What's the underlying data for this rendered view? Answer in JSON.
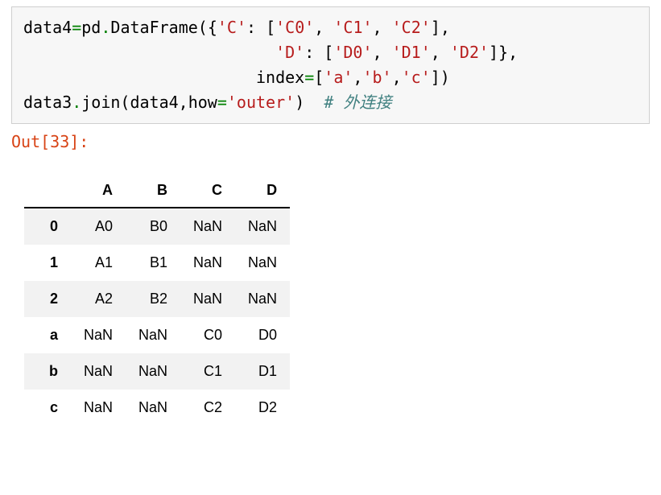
{
  "code": {
    "l1_p1": "data4",
    "l1_eq": "=",
    "l1_p2": "pd",
    "l1_dot": ".",
    "l1_p3": "DataFrame({",
    "l1_s1": "'C'",
    "l1_p4": ": [",
    "l1_s2": "'C0'",
    "l1_c1": ", ",
    "l1_s3": "'C1'",
    "l1_c2": ", ",
    "l1_s4": "'C2'",
    "l1_p5": "],",
    "l2_pad": "                          ",
    "l2_s1": "'D'",
    "l2_p1": ": [",
    "l2_s2": "'D0'",
    "l2_c1": ", ",
    "l2_s3": "'D1'",
    "l2_c2": ", ",
    "l2_s4": "'D2'",
    "l2_p2": "]},",
    "l3_pad": "                        ",
    "l3_kw": "index",
    "l3_eq": "=",
    "l3_p1": "[",
    "l3_s1": "'a'",
    "l3_c1": ",",
    "l3_s2": "'b'",
    "l3_c2": ",",
    "l3_s3": "'c'",
    "l3_p2": "])",
    "l4_p1": "data3",
    "l4_dot": ".",
    "l4_p2": "join(data4,how",
    "l4_eq": "=",
    "l4_s1": "'outer'",
    "l4_p3": ")  ",
    "l4_comment": "# 外连接"
  },
  "out_label": "Out[33]:",
  "chart_data": {
    "type": "table",
    "columns": [
      "",
      "A",
      "B",
      "C",
      "D"
    ],
    "rows": [
      {
        "idx": "0",
        "A": "A0",
        "B": "B0",
        "C": "NaN",
        "D": "NaN"
      },
      {
        "idx": "1",
        "A": "A1",
        "B": "B1",
        "C": "NaN",
        "D": "NaN"
      },
      {
        "idx": "2",
        "A": "A2",
        "B": "B2",
        "C": "NaN",
        "D": "NaN"
      },
      {
        "idx": "a",
        "A": "NaN",
        "B": "NaN",
        "C": "C0",
        "D": "D0"
      },
      {
        "idx": "b",
        "A": "NaN",
        "B": "NaN",
        "C": "C1",
        "D": "D1"
      },
      {
        "idx": "c",
        "A": "NaN",
        "B": "NaN",
        "C": "C2",
        "D": "D2"
      }
    ]
  }
}
